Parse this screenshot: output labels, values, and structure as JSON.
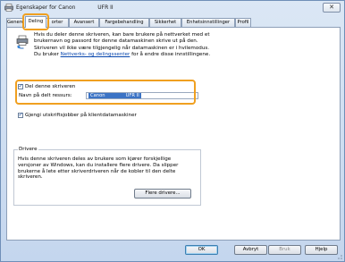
{
  "window": {
    "title": "Egenskaper for Canon             UFR II",
    "close_label": "✕"
  },
  "tabs": [
    {
      "label": "Genere"
    },
    {
      "label": "Deling"
    },
    {
      "label": "orter"
    },
    {
      "label": "Avansert"
    },
    {
      "label": "Fargebehandling"
    },
    {
      "label": "Sikkerhet"
    },
    {
      "label": "Enhetsinnstillinger"
    },
    {
      "label": "Profil"
    }
  ],
  "sharing": {
    "info_line1": "Hvis du deler denne skriveren, kan bare brukere på nettverket med et",
    "info_line2": "brukernavn og passord for denne datamaskinen skrive ut på den.",
    "info_line3": "Skriveren vil ikke være tilgjengelig når datamaskinen er i hvilemodus.",
    "info_prefix": "Du bruker ",
    "info_link": "Nettverks- og delingssenter",
    "info_suffix": " for å endre disse innstillingene.",
    "share_checkbox_label": "Del denne skriveren",
    "share_name_label": "Navn på delt ressurs:",
    "share_name_value": "Canon              UFR II",
    "render_checkbox_label": "Gjengi utskriftsjobber på klientdatamaskiner"
  },
  "drivers": {
    "title": "Drivere",
    "text": "Hvis denne skriveren deles av brukere som kjører forskjellige versjoner av Windows, kan du installere flere drivere. Da slipper brukerne å lete etter skriverdriveren når de kobler til den delte skriveren.",
    "button_label": "Flere drivere..."
  },
  "footer": {
    "ok_label": "OK",
    "cancel_label": "Avbryt",
    "apply_label": "Bruk",
    "help_label": "Hjelp"
  },
  "icons": {
    "app": "printer-icon",
    "share": "shared-printer-icon",
    "check": "✓",
    "accent": "#f0a020"
  }
}
